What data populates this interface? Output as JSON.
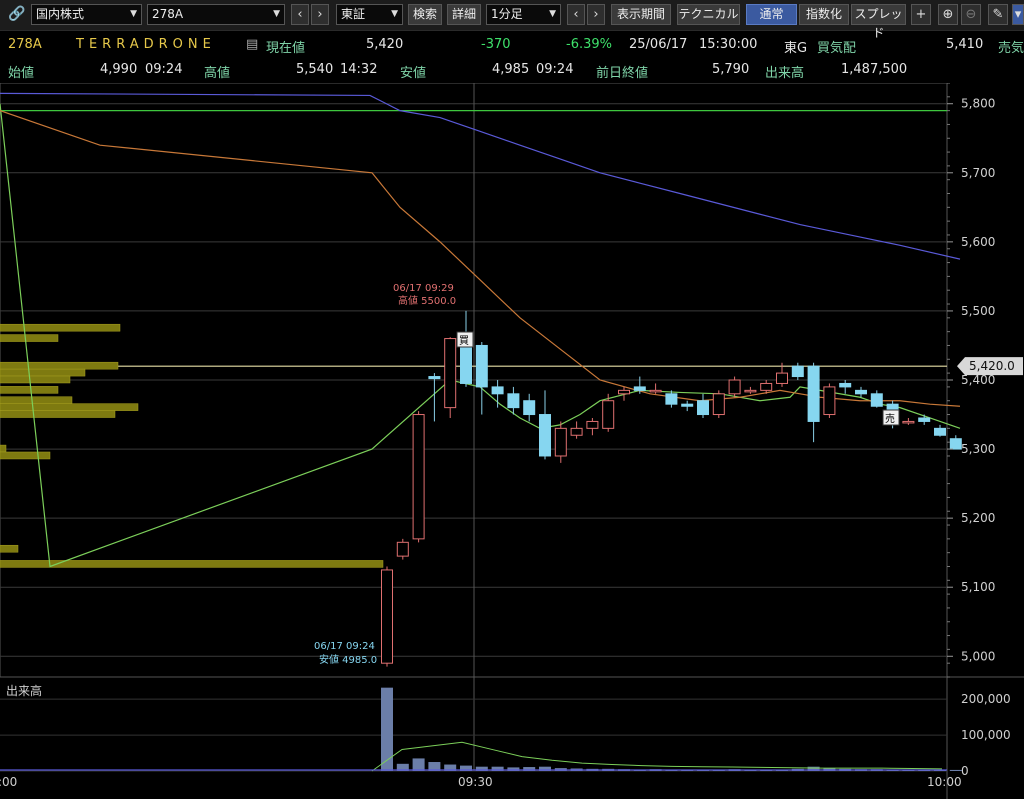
{
  "toolbar": {
    "market_select": "国内株式",
    "symbol_input": "278A",
    "exchange_select": "東証",
    "search_label": "検索",
    "detail_label": "詳細",
    "interval_select": "1分足",
    "display_period_label": "表示期間",
    "technical_label": "テクニカル",
    "normal_label": "通常",
    "index_label": "指数化",
    "spread_label": "スプレッド"
  },
  "quote": {
    "code": "278A",
    "name": "TERRADRONE",
    "current_label": "現在値",
    "current_value": "5,420",
    "change": "-370",
    "change_pct": "-6.39%",
    "date": "25/06/17",
    "time": "15:30:00",
    "market": "東G",
    "bid_label": "買気配",
    "bid_value": "5,410",
    "ask_label": "売気",
    "open_label": "始値",
    "open_value": "4,990",
    "open_time": "09:24",
    "high_label": "高値",
    "high_value": "5,540",
    "high_time": "14:32",
    "low_label": "安値",
    "low_value": "4,985",
    "low_time": "09:24",
    "prev_close_label": "前日終値",
    "prev_close_value": "5,790",
    "volume_label": "出来高",
    "volume_value": "1,487,500"
  },
  "chart_data": {
    "type": "candlestick",
    "price_axis": {
      "ylim": [
        4970,
        5830
      ],
      "ticks": [
        "5,800",
        "5,700",
        "5,600",
        "5,500",
        "5,400",
        "5,300",
        "5,200",
        "5,100",
        "5,000"
      ]
    },
    "volume_axis": {
      "label": "出来高",
      "ylim": [
        0,
        245000
      ],
      "ticks": [
        "200,000",
        "100,000",
        "0"
      ]
    },
    "x_ticks": [
      ":00",
      "09:30",
      "10:00"
    ],
    "current_price_label": "5,420.0",
    "current_price": 5420,
    "prev_close_line": 5790,
    "high_annotation": {
      "date": "06/17 09:29",
      "text": "高値 5500.0"
    },
    "low_annotation": {
      "date": "06/17 09:24",
      "text": "安値 4985.0"
    },
    "buy_marker": "買",
    "sell_marker": "売",
    "candles": [
      {
        "t": "09:24",
        "o": 4990,
        "h": 5130,
        "l": 4985,
        "c": 5125
      },
      {
        "t": "09:25",
        "o": 5145,
        "h": 5170,
        "l": 5140,
        "c": 5165
      },
      {
        "t": "09:26",
        "o": 5170,
        "h": 5355,
        "l": 5165,
        "c": 5350
      },
      {
        "t": "09:27",
        "o": 5405,
        "h": 5410,
        "l": 5340,
        "c": 5402
      },
      {
        "t": "09:28",
        "o": 5360,
        "h": 5462,
        "l": 5345,
        "c": 5460
      },
      {
        "t": "09:29",
        "o": 5460,
        "h": 5500,
        "l": 5390,
        "c": 5395
      },
      {
        "t": "09:30",
        "o": 5450,
        "h": 5455,
        "l": 5350,
        "c": 5390
      },
      {
        "t": "09:31",
        "o": 5390,
        "h": 5400,
        "l": 5360,
        "c": 5380
      },
      {
        "t": "09:32",
        "o": 5380,
        "h": 5390,
        "l": 5350,
        "c": 5360
      },
      {
        "t": "09:33",
        "o": 5370,
        "h": 5380,
        "l": 5340,
        "c": 5350
      },
      {
        "t": "09:34",
        "o": 5350,
        "h": 5385,
        "l": 5285,
        "c": 5290
      },
      {
        "t": "09:35",
        "o": 5290,
        "h": 5340,
        "l": 5280,
        "c": 5330
      },
      {
        "t": "09:36",
        "o": 5320,
        "h": 5340,
        "l": 5315,
        "c": 5330
      },
      {
        "t": "09:37",
        "o": 5330,
        "h": 5345,
        "l": 5320,
        "c": 5340
      },
      {
        "t": "09:38",
        "o": 5330,
        "h": 5380,
        "l": 5325,
        "c": 5370
      },
      {
        "t": "09:39",
        "o": 5380,
        "h": 5390,
        "l": 5370,
        "c": 5385
      },
      {
        "t": "09:40",
        "o": 5390,
        "h": 5405,
        "l": 5380,
        "c": 5385
      },
      {
        "t": "09:41",
        "o": 5385,
        "h": 5395,
        "l": 5380,
        "c": 5385
      },
      {
        "t": "09:42",
        "o": 5380,
        "h": 5385,
        "l": 5360,
        "c": 5365
      },
      {
        "t": "09:43",
        "o": 5365,
        "h": 5370,
        "l": 5355,
        "c": 5362
      },
      {
        "t": "09:44",
        "o": 5370,
        "h": 5380,
        "l": 5345,
        "c": 5350
      },
      {
        "t": "09:45",
        "o": 5350,
        "h": 5385,
        "l": 5345,
        "c": 5380
      },
      {
        "t": "09:46",
        "o": 5380,
        "h": 5405,
        "l": 5375,
        "c": 5400
      },
      {
        "t": "09:47",
        "o": 5385,
        "h": 5390,
        "l": 5380,
        "c": 5385
      },
      {
        "t": "09:48",
        "o": 5385,
        "h": 5400,
        "l": 5380,
        "c": 5395
      },
      {
        "t": "09:49",
        "o": 5395,
        "h": 5425,
        "l": 5390,
        "c": 5410
      },
      {
        "t": "09:50",
        "o": 5420,
        "h": 5425,
        "l": 5400,
        "c": 5405
      },
      {
        "t": "09:51",
        "o": 5420,
        "h": 5425,
        "l": 5310,
        "c": 5340
      },
      {
        "t": "09:52",
        "o": 5350,
        "h": 5395,
        "l": 5345,
        "c": 5390
      },
      {
        "t": "09:53",
        "o": 5395,
        "h": 5400,
        "l": 5380,
        "c": 5390
      },
      {
        "t": "09:54",
        "o": 5385,
        "h": 5390,
        "l": 5375,
        "c": 5380
      },
      {
        "t": "09:55",
        "o": 5380,
        "h": 5385,
        "l": 5360,
        "c": 5362
      },
      {
        "t": "09:56",
        "o": 5365,
        "h": 5370,
        "l": 5330,
        "c": 5335
      },
      {
        "t": "09:57",
        "o": 5340,
        "h": 5345,
        "l": 5335,
        "c": 5340
      },
      {
        "t": "09:58",
        "o": 5345,
        "h": 5350,
        "l": 5335,
        "c": 5340
      },
      {
        "t": "09:59",
        "o": 5330,
        "h": 5335,
        "l": 5318,
        "c": 5320
      },
      {
        "t": "10:00",
        "o": 5315,
        "h": 5320,
        "l": 5300,
        "c": 5300
      }
    ],
    "volume": [
      232000,
      20000,
      35000,
      25000,
      18000,
      15000,
      12000,
      12000,
      10000,
      11000,
      12000,
      8000,
      7000,
      6000,
      6000,
      5000,
      4000,
      5000,
      3000,
      4000,
      4000,
      4000,
      5000,
      4000,
      3000,
      4000,
      6000,
      12000,
      8000,
      6000,
      5000,
      5000,
      4000,
      3000,
      3000,
      3000,
      3000
    ],
    "series": [
      {
        "values": [
          5800,
          5130,
          5300,
          5400,
          5390,
          5365,
          5345,
          5330,
          5335,
          5350,
          5370,
          5385,
          5382,
          5380,
          5370,
          5375,
          5390,
          5385,
          5375,
          5365,
          5360,
          5345,
          5330
        ]
      },
      {
        "values": [
          5790,
          5740,
          5700,
          5650,
          5600,
          5545,
          5490,
          5445,
          5400,
          5380,
          5370,
          5375,
          5380,
          5385,
          5380,
          5375,
          5370,
          5370,
          5365,
          5362
        ]
      },
      {
        "values": [
          5815,
          5812,
          5790,
          5780,
          5760,
          5740,
          5720,
          5700,
          5685,
          5670,
          5655,
          5640,
          5625,
          5610,
          5595,
          5575
        ]
      }
    ],
    "volume_ma": [
      0,
      60000,
      70000,
      80000,
      60000,
      40000,
      30000,
      22000,
      18000,
      15000,
      13000,
      12000,
      11000,
      10000,
      9000,
      8000,
      8000,
      8000,
      7000,
      6000
    ],
    "volume_profile": [
      {
        "price": 5475,
        "volume": 120
      },
      {
        "price": 5460,
        "volume": 58
      },
      {
        "price": 5420,
        "volume": 118
      },
      {
        "price": 5410,
        "volume": 85
      },
      {
        "price": 5400,
        "volume": 70
      },
      {
        "price": 5385,
        "volume": 58
      },
      {
        "price": 5370,
        "volume": 72
      },
      {
        "price": 5360,
        "volume": 138
      },
      {
        "price": 5350,
        "volume": 115
      },
      {
        "price": 5300,
        "volume": 6
      },
      {
        "price": 5290,
        "volume": 50
      },
      {
        "price": 5155,
        "volume": 18
      },
      {
        "price": 5133,
        "volume": 383
      }
    ]
  }
}
